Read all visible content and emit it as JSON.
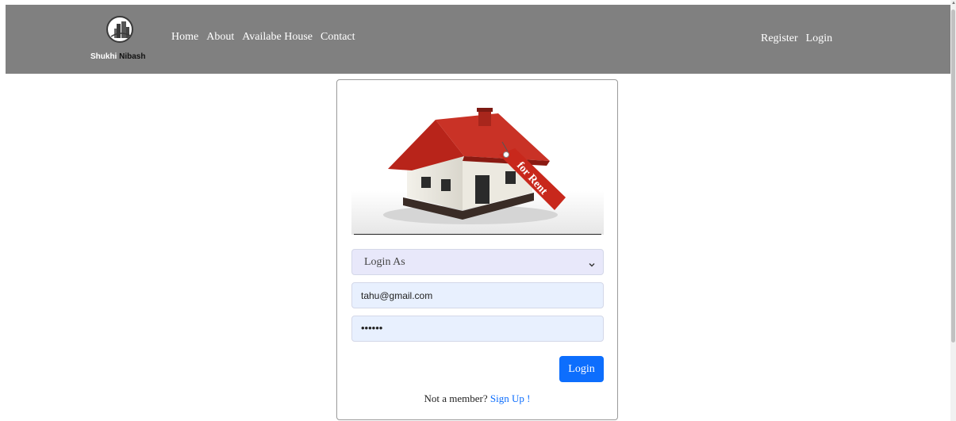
{
  "brand": {
    "first_name": "Shukhi",
    "second_name": "Nibash"
  },
  "nav": {
    "left_links": [
      "Home",
      "About",
      "Availabe House",
      "Contact"
    ],
    "right_links": [
      "Register",
      "Login"
    ]
  },
  "login_card": {
    "image_tag_text": "for Rent",
    "login_as": {
      "selected": "Login As"
    },
    "email": {
      "value": "tahu@gmail.com"
    },
    "password": {
      "value": "••••••"
    },
    "login_button": "Login",
    "not_member_text": "Not a member?",
    "signup_link": "Sign Up !"
  },
  "colors": {
    "navbar_bg": "#808080",
    "primary_button": "#0d6efd",
    "input_autofill": "#e8f0fe",
    "roof": "#c0281d"
  }
}
